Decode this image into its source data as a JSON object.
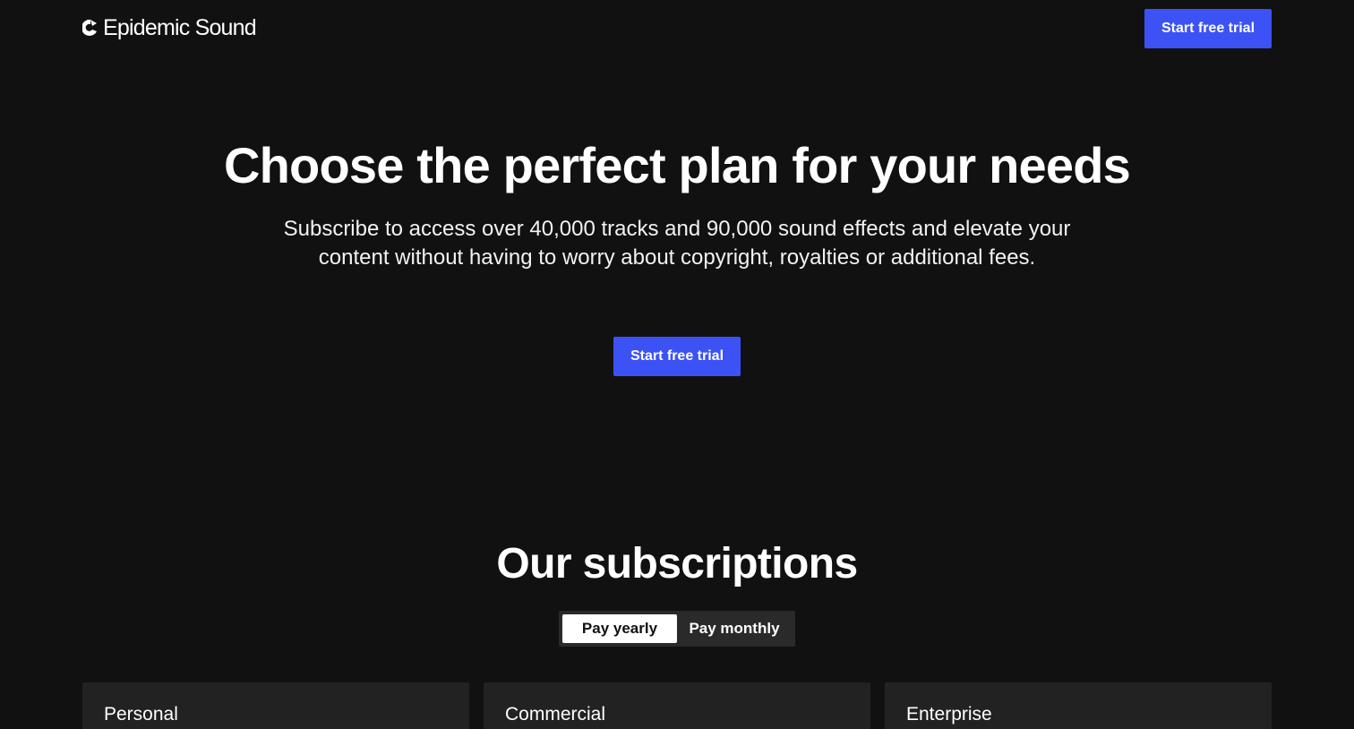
{
  "header": {
    "logo_text": "Epidemic Sound",
    "cta_label": "Start free trial"
  },
  "hero": {
    "title": "Choose the perfect plan for your needs",
    "subtitle": "Subscribe to access over 40,000 tracks and 90,000 sound effects and elevate your content without having to worry about copyright, royalties or additional fees.",
    "cta_label": "Start free trial"
  },
  "subscriptions": {
    "title": "Our subscriptions",
    "billing_toggle": {
      "options": [
        "Pay yearly",
        "Pay monthly"
      ],
      "selected": "Pay yearly"
    },
    "plans": [
      {
        "name": "Personal"
      },
      {
        "name": "Commercial"
      },
      {
        "name": "Enterprise"
      }
    ]
  },
  "colors": {
    "background": "#111111",
    "accent": "#3d52f5",
    "card_background": "#222222",
    "toggle_background": "#2a2a2a"
  }
}
